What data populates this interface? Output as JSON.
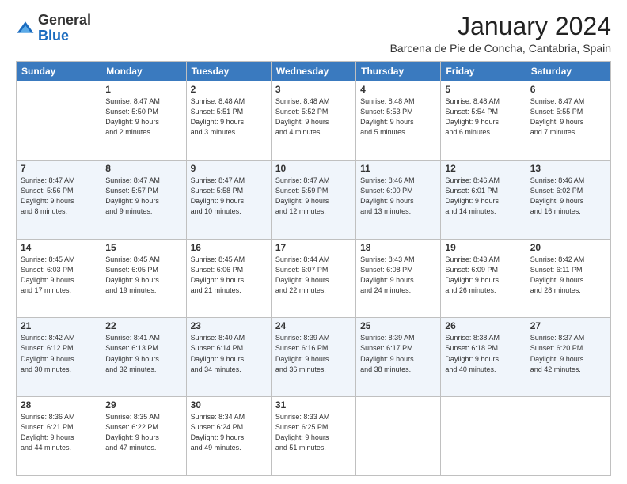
{
  "header": {
    "logo_general": "General",
    "logo_blue": "Blue",
    "month": "January 2024",
    "location": "Barcena de Pie de Concha, Cantabria, Spain"
  },
  "weekdays": [
    "Sunday",
    "Monday",
    "Tuesday",
    "Wednesday",
    "Thursday",
    "Friday",
    "Saturday"
  ],
  "weeks": [
    [
      {
        "day": "",
        "info": ""
      },
      {
        "day": "1",
        "info": "Sunrise: 8:47 AM\nSunset: 5:50 PM\nDaylight: 9 hours\nand 2 minutes."
      },
      {
        "day": "2",
        "info": "Sunrise: 8:48 AM\nSunset: 5:51 PM\nDaylight: 9 hours\nand 3 minutes."
      },
      {
        "day": "3",
        "info": "Sunrise: 8:48 AM\nSunset: 5:52 PM\nDaylight: 9 hours\nand 4 minutes."
      },
      {
        "day": "4",
        "info": "Sunrise: 8:48 AM\nSunset: 5:53 PM\nDaylight: 9 hours\nand 5 minutes."
      },
      {
        "day": "5",
        "info": "Sunrise: 8:48 AM\nSunset: 5:54 PM\nDaylight: 9 hours\nand 6 minutes."
      },
      {
        "day": "6",
        "info": "Sunrise: 8:47 AM\nSunset: 5:55 PM\nDaylight: 9 hours\nand 7 minutes."
      }
    ],
    [
      {
        "day": "7",
        "info": "Sunrise: 8:47 AM\nSunset: 5:56 PM\nDaylight: 9 hours\nand 8 minutes."
      },
      {
        "day": "8",
        "info": "Sunrise: 8:47 AM\nSunset: 5:57 PM\nDaylight: 9 hours\nand 9 minutes."
      },
      {
        "day": "9",
        "info": "Sunrise: 8:47 AM\nSunset: 5:58 PM\nDaylight: 9 hours\nand 10 minutes."
      },
      {
        "day": "10",
        "info": "Sunrise: 8:47 AM\nSunset: 5:59 PM\nDaylight: 9 hours\nand 12 minutes."
      },
      {
        "day": "11",
        "info": "Sunrise: 8:46 AM\nSunset: 6:00 PM\nDaylight: 9 hours\nand 13 minutes."
      },
      {
        "day": "12",
        "info": "Sunrise: 8:46 AM\nSunset: 6:01 PM\nDaylight: 9 hours\nand 14 minutes."
      },
      {
        "day": "13",
        "info": "Sunrise: 8:46 AM\nSunset: 6:02 PM\nDaylight: 9 hours\nand 16 minutes."
      }
    ],
    [
      {
        "day": "14",
        "info": "Sunrise: 8:45 AM\nSunset: 6:03 PM\nDaylight: 9 hours\nand 17 minutes."
      },
      {
        "day": "15",
        "info": "Sunrise: 8:45 AM\nSunset: 6:05 PM\nDaylight: 9 hours\nand 19 minutes."
      },
      {
        "day": "16",
        "info": "Sunrise: 8:45 AM\nSunset: 6:06 PM\nDaylight: 9 hours\nand 21 minutes."
      },
      {
        "day": "17",
        "info": "Sunrise: 8:44 AM\nSunset: 6:07 PM\nDaylight: 9 hours\nand 22 minutes."
      },
      {
        "day": "18",
        "info": "Sunrise: 8:43 AM\nSunset: 6:08 PM\nDaylight: 9 hours\nand 24 minutes."
      },
      {
        "day": "19",
        "info": "Sunrise: 8:43 AM\nSunset: 6:09 PM\nDaylight: 9 hours\nand 26 minutes."
      },
      {
        "day": "20",
        "info": "Sunrise: 8:42 AM\nSunset: 6:11 PM\nDaylight: 9 hours\nand 28 minutes."
      }
    ],
    [
      {
        "day": "21",
        "info": "Sunrise: 8:42 AM\nSunset: 6:12 PM\nDaylight: 9 hours\nand 30 minutes."
      },
      {
        "day": "22",
        "info": "Sunrise: 8:41 AM\nSunset: 6:13 PM\nDaylight: 9 hours\nand 32 minutes."
      },
      {
        "day": "23",
        "info": "Sunrise: 8:40 AM\nSunset: 6:14 PM\nDaylight: 9 hours\nand 34 minutes."
      },
      {
        "day": "24",
        "info": "Sunrise: 8:39 AM\nSunset: 6:16 PM\nDaylight: 9 hours\nand 36 minutes."
      },
      {
        "day": "25",
        "info": "Sunrise: 8:39 AM\nSunset: 6:17 PM\nDaylight: 9 hours\nand 38 minutes."
      },
      {
        "day": "26",
        "info": "Sunrise: 8:38 AM\nSunset: 6:18 PM\nDaylight: 9 hours\nand 40 minutes."
      },
      {
        "day": "27",
        "info": "Sunrise: 8:37 AM\nSunset: 6:20 PM\nDaylight: 9 hours\nand 42 minutes."
      }
    ],
    [
      {
        "day": "28",
        "info": "Sunrise: 8:36 AM\nSunset: 6:21 PM\nDaylight: 9 hours\nand 44 minutes."
      },
      {
        "day": "29",
        "info": "Sunrise: 8:35 AM\nSunset: 6:22 PM\nDaylight: 9 hours\nand 47 minutes."
      },
      {
        "day": "30",
        "info": "Sunrise: 8:34 AM\nSunset: 6:24 PM\nDaylight: 9 hours\nand 49 minutes."
      },
      {
        "day": "31",
        "info": "Sunrise: 8:33 AM\nSunset: 6:25 PM\nDaylight: 9 hours\nand 51 minutes."
      },
      {
        "day": "",
        "info": ""
      },
      {
        "day": "",
        "info": ""
      },
      {
        "day": "",
        "info": ""
      }
    ]
  ]
}
